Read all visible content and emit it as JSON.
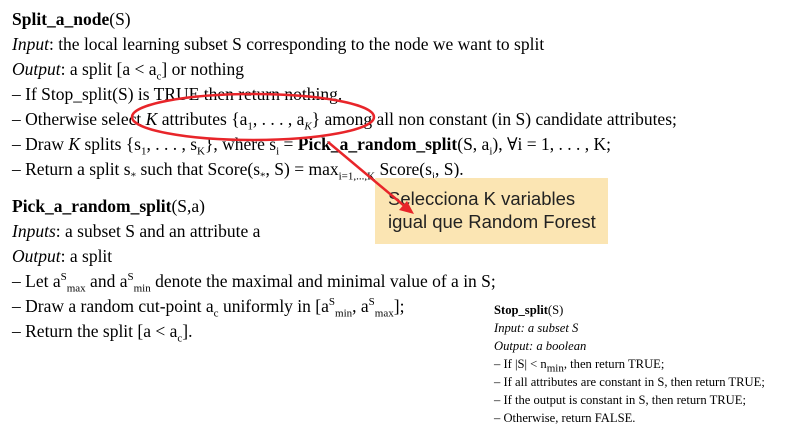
{
  "algo1": {
    "title": "Split_a_node",
    "title_arg": "(S)",
    "input_label": "Input",
    "input_text": ": the local learning subset S corresponding to the node we want to split",
    "output_label": "Output",
    "output_text": ": a split [a < a",
    "output_sub": "c",
    "output_tail": "] or nothing",
    "line1": "– If Stop_split(S) is TRUE then return nothing.",
    "line1_strong": "Stop_split",
    "line2_pre": "– Otherwise select ",
    "line2_k": "K",
    "line2_mid": " attributes {a",
    "line2_tail": "} among all non constant (in S) candidate attributes;",
    "line3_pre": "– Draw ",
    "line3_k": "K",
    "line3_mid": " splits {s",
    "line3_b": "Pick_a_random_split",
    "line3_tail": "(S, a",
    "line3_end": "), ∀i = 1, . . . , K;",
    "line4_pre": "– Return a split s",
    "line4_mid": " such that Score(s",
    "line4_tail": ", S) = max",
    "line4_sub": "i=1,...,K",
    "line4_end": " Score(s",
    "line4_last": ", S)."
  },
  "algo2": {
    "title": "Pick_a_random_split",
    "title_arg": "(S,a)",
    "inputs_label": "Inputs",
    "inputs_text": ": a subset S and an attribute a",
    "output_label": "Output",
    "output_text": ": a split",
    "line1_pre": "– Let a",
    "line1_mid": " and a",
    "line1_tail": " denote the maximal and minimal value of a in S;",
    "line2_pre": "– Draw a random cut-point a",
    "line2_mid": " uniformly in [a",
    "line2_tail": "];",
    "line3": "– Return the split [a < a",
    "line3_end": "]."
  },
  "algo3": {
    "title": "Stop_split",
    "title_arg": "(S)",
    "input_label": "Input:",
    "input_text": " a subset S",
    "output_label": "Output:",
    "output_text": " a boolean",
    "line1_pre": "– If |S| < n",
    "line1_sub": "min",
    "line1_tail": ", then return TRUE;",
    "line2": "– If all attributes are constant in S, then return TRUE;",
    "line3": "– If the output is constant in S, then return TRUE;",
    "line4": "– Otherwise, return FALSE."
  },
  "annotation": {
    "line1": "Selecciona K variables",
    "line2": "igual que Random Forest",
    "circle_color": "#e8252a",
    "arrow_color": "#e8252a",
    "box_color": "#fbe5b3"
  }
}
